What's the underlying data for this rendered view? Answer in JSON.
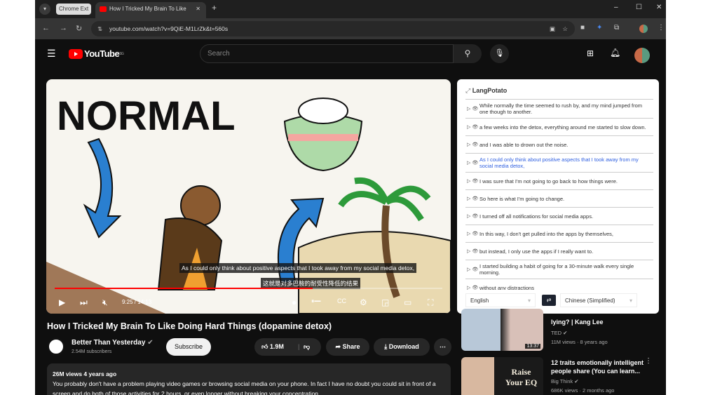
{
  "browser": {
    "tab_group": "Chrome Ext",
    "tab_title": "How I Tricked My Brain To Like",
    "url": "youtube.com/watch?v=9QiE-M1LrZk&t=560s"
  },
  "youtube": {
    "logo": "YouTube",
    "region": "SG",
    "search_placeholder": "Search"
  },
  "video": {
    "illustration_text": "NORMAL",
    "subtitle_en": "As I could only think about positive aspects that I took away from my social media detox,",
    "subtitle_zh": "这就是对多巴胺的耐受性降低的结果",
    "time": "9:25 / 14:13",
    "progress_percent": 66.5
  },
  "panel": {
    "title": "LangPotato",
    "rows": [
      "While normally the time seemed to rush by, and my mind jumped from one though to another.",
      "a few weeks into the detox, everything around me started to slow down.",
      "and I was able to drown out the noise.",
      "As I could only think about positive aspects that I took away from my social media detox,",
      "I was sure that I'm not going to go back to how things were.",
      "So here is what I'm going to change.",
      "I turned off all notifications for social media apps.",
      "In this way, I don't get pulled into the apps by themselves,",
      "but instead, I only use the apps if I really want to.",
      "I started building a habit of going for a 30-minute walk every single morning.",
      "without any distractions"
    ],
    "active_row": 3,
    "source_lang": "English",
    "target_lang": "Chinese (Simplified)"
  },
  "watch": {
    "title": "How I Tricked My Brain To Like Doing Hard Things (dopamine detox)",
    "channel": "Better Than Yesterday",
    "subscribers": "2.54M subscribers",
    "subscribe": "Subscribe",
    "likes": "1.9M",
    "share": "Share",
    "download": "Download",
    "views_age": "26M views  4 years ago",
    "description": "You probably don't have a problem playing video games or browsing social media on your phone. In fact I have no doubt you could sit in front of a screen and do both of those activities for 2 hours, or even longer without breaking your concentration."
  },
  "recommendations": [
    {
      "title": "lying? | Kang Lee",
      "channel": "TED",
      "meta": "11M views · 8 years ago",
      "duration": "13:37"
    },
    {
      "title": "12 traits emotionally intelligent people share (You can learn...",
      "channel": "Big Think",
      "meta": "686K views · 2 months ago",
      "thumb_text": "Raise Your EQ"
    }
  ]
}
